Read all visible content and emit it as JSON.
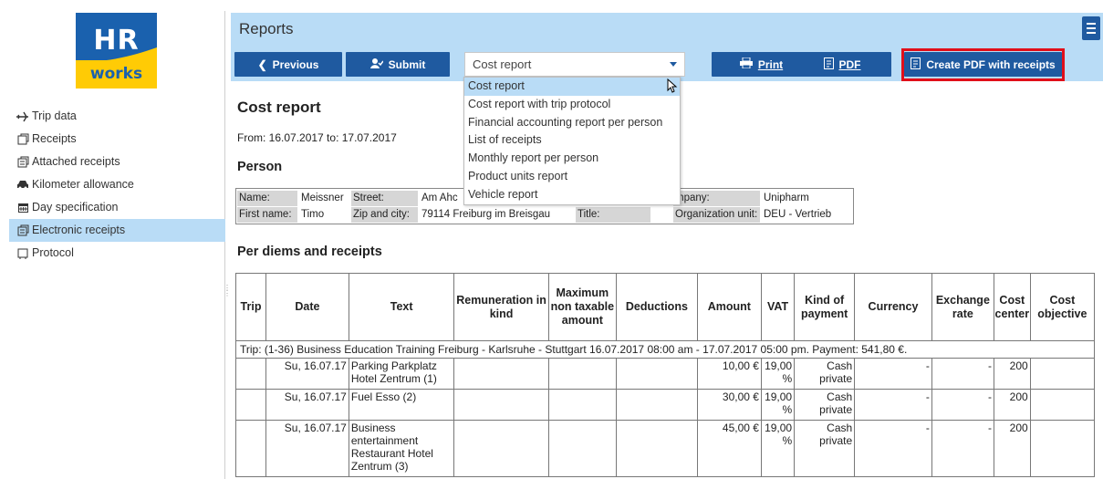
{
  "header": {
    "title": "Reports"
  },
  "logo": {
    "top_text": "HR",
    "bottom_text": "works"
  },
  "sidebar": {
    "items": [
      {
        "label": "Trip data",
        "icon": "plane-icon"
      },
      {
        "label": "Receipts",
        "icon": "receipt-icon"
      },
      {
        "label": "Attached receipts",
        "icon": "attached-receipt-icon"
      },
      {
        "label": "Kilometer allowance",
        "icon": "car-icon"
      },
      {
        "label": "Day specification",
        "icon": "calendar-icon"
      },
      {
        "label": "Electronic receipts",
        "icon": "electronic-receipt-icon",
        "active": true
      },
      {
        "label": "Protocol",
        "icon": "protocol-icon"
      }
    ]
  },
  "toolbar": {
    "previous_label": "Previous",
    "submit_label": "Submit",
    "report_select_value": "Cost report",
    "print_label": "Print",
    "pdf_label": "PDF",
    "create_pdf_label": "Create PDF with receipts"
  },
  "dropdown": {
    "options": [
      "Cost report",
      "Cost report with trip protocol",
      "Financial accounting report per person",
      "List of receipts",
      "Monthly report per person",
      "Product units report",
      "Vehicle report"
    ],
    "selected": "Cost report"
  },
  "report": {
    "title": "Cost report",
    "from_to": "From: 16.07.2017 to: 17.07.2017",
    "person_heading": "Person",
    "person": {
      "name_label": "Name:",
      "name_value": "Meissner",
      "street_label": "Street:",
      "street_value": "Am Ahc",
      "company_label": "mpany:",
      "company_value": "Unipharm",
      "first_name_label": "First name:",
      "first_name_value": "Timo",
      "zip_label": "Zip and city:",
      "zip_value": "79114 Freiburg im Breisgau",
      "title_label": "Title:",
      "title_value": "",
      "org_label": "Organization unit:",
      "org_value": "DEU - Vertrieb"
    },
    "per_diems_heading": "Per diems and receipts",
    "columns": [
      "Trip",
      "Date",
      "Text",
      "Remuneration in kind",
      "Maximum non taxable amount",
      "Deductions",
      "Amount",
      "VAT",
      "Kind of payment",
      "Currency",
      "Exchange rate",
      "Cost center",
      "Cost objective"
    ],
    "trip_line": "Trip: (1-36) Business Education Training Freiburg - Karlsruhe - Stuttgart 16.07.2017 08:00 am - 17.07.2017 05:00 pm. Payment: 541,80 €.",
    "rows": [
      {
        "date": "Su, 16.07.17",
        "text": "Parking Parkplatz Hotel Zentrum (1)",
        "amount": "10,00 €",
        "vat": "19,00 %",
        "payment": "Cash private",
        "currency": "-",
        "rate": "-",
        "cost_center": "200"
      },
      {
        "date": "Su, 16.07.17",
        "text": "Fuel Esso (2)",
        "amount": "30,00 €",
        "vat": "19,00 %",
        "payment": "Cash private",
        "currency": "-",
        "rate": "-",
        "cost_center": "200"
      },
      {
        "date": "Su, 16.07.17",
        "text": "Business entertainment Restaurant Hotel Zentrum (3)",
        "amount": "45,00 €",
        "vat": "19,00 %",
        "payment": "Cash private",
        "currency": "-",
        "rate": "-",
        "cost_center": "200"
      }
    ]
  },
  "colors": {
    "accent_blue": "#1f5aa0",
    "header_bg": "#b9dcf6",
    "highlight_red": "#e10f1a",
    "logo_yellow": "#ffcb05"
  }
}
